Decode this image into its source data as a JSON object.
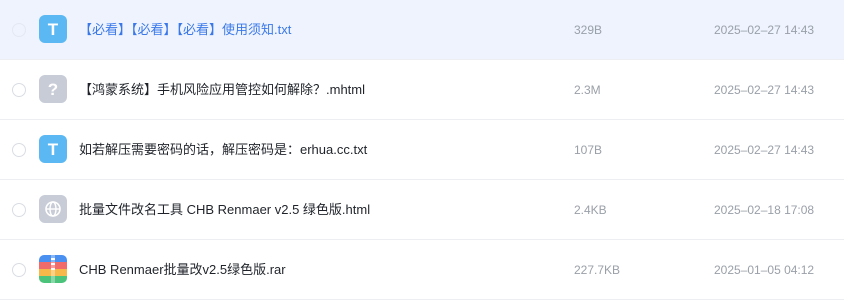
{
  "colors": {
    "accent": "#3a78e8",
    "hover_bg": "#eef3fe",
    "muted": "#9aa0a8"
  },
  "files": [
    {
      "icon": "text-file-icon",
      "name": "【必看】【必看】【必看】使用须知.txt",
      "size": "329B",
      "date": "2025–02–27 14:43",
      "hovered": true
    },
    {
      "icon": "unknown-file-icon",
      "name": "【鸿蒙系统】手机风险应用管控如何解除？.mhtml",
      "size": "2.3M",
      "date": "2025–02–27 14:43",
      "hovered": false
    },
    {
      "icon": "text-file-icon",
      "name": "如若解压需要密码的话，解压密码是：erhua.cc.txt",
      "size": "107B",
      "date": "2025–02–27 14:43",
      "hovered": false
    },
    {
      "icon": "web-file-icon",
      "name": "批量文件改名工具 CHB Renmaer v2.5 绿色版.html",
      "size": "2.4KB",
      "date": "2025–02–18 17:08",
      "hovered": false
    },
    {
      "icon": "archive-file-icon",
      "name": "CHB Renmaer批量改v2.5绿色版.rar",
      "size": "227.7KB",
      "date": "2025–01–05 04:12",
      "hovered": false
    }
  ]
}
